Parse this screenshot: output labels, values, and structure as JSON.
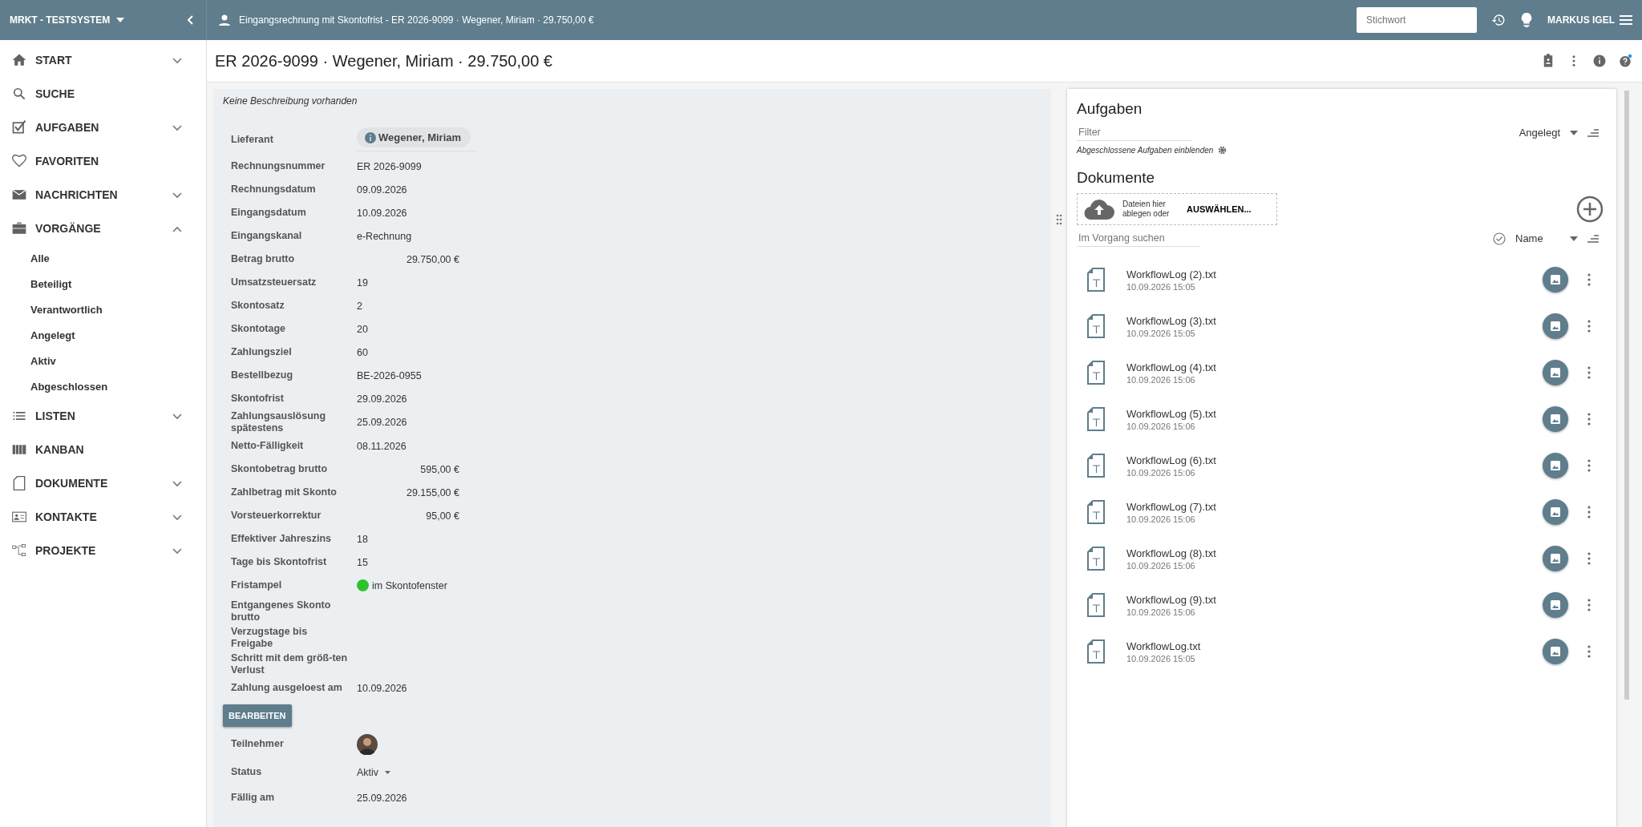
{
  "topbar": {
    "system": "MRKT - TESTSYSTEM",
    "title": "Eingangsrechnung mit Skontofrist - ER 2026-9099 · Wegener, Miriam · 29.750,00 €",
    "search": {
      "placeholder": "Stichwort"
    },
    "user": "MARKUS IGEL"
  },
  "sidebar": {
    "items": [
      {
        "label": "START",
        "expanded": false
      },
      {
        "label": "SUCHE"
      },
      {
        "label": "AUFGABEN",
        "expanded": false
      },
      {
        "label": "FAVORITEN"
      },
      {
        "label": "NACHRICHTEN",
        "expanded": false
      },
      {
        "label": "VORGÄNGE",
        "expanded": true,
        "children": [
          {
            "label": "Alle"
          },
          {
            "label": "Beteiligt"
          },
          {
            "label": "Verantwortlich"
          },
          {
            "label": "Angelegt"
          },
          {
            "label": "Aktiv"
          },
          {
            "label": "Abgeschlossen"
          }
        ]
      },
      {
        "label": "LISTEN",
        "expanded": false
      },
      {
        "label": "KANBAN"
      },
      {
        "label": "DOKUMENTE",
        "expanded": false
      },
      {
        "label": "KONTAKTE",
        "expanded": false
      },
      {
        "label": "PROJEKTE",
        "expanded": false
      }
    ]
  },
  "page_title": "ER 2026-9099 · Wegener, Miriam · 29.750,00 €",
  "details": {
    "description": "Keine Beschreibung vorhanden",
    "fields": [
      {
        "label": "Lieferant",
        "kind": "chip",
        "value": "Wegener, Miriam"
      },
      {
        "label": "Rechnungsnummer",
        "kind": "text",
        "value": "ER 2026-9099"
      },
      {
        "label": "Rechnungsdatum",
        "kind": "text",
        "value": "09.09.2026"
      },
      {
        "label": "Eingangsdatum",
        "kind": "text",
        "value": "10.09.2026"
      },
      {
        "label": "Eingangskanal",
        "kind": "text",
        "value": "e-Rechnung"
      },
      {
        "label": "Betrag brutto",
        "kind": "amount",
        "value": "29.750,00 €"
      },
      {
        "label": "Umsatzsteuersatz",
        "kind": "text",
        "value": "19"
      },
      {
        "label": "Skontosatz",
        "kind": "text",
        "value": "2"
      },
      {
        "label": "Skontotage",
        "kind": "text",
        "value": "20"
      },
      {
        "label": "Zahlungsziel",
        "kind": "text",
        "value": "60"
      },
      {
        "label": "Bestellbezug",
        "kind": "text",
        "value": "BE-2026-0955"
      },
      {
        "label": "Skontofrist",
        "kind": "text",
        "value": "29.09.2026"
      },
      {
        "label": "Zahlungsauslösung spätestens",
        "kind": "text",
        "value": "25.09.2026"
      },
      {
        "label": "Netto-Fälligkeit",
        "kind": "text",
        "value": "08.11.2026"
      },
      {
        "label": "Skontobetrag brutto",
        "kind": "amount",
        "value": "595,00 €"
      },
      {
        "label": "Zahlbetrag mit Skonto",
        "kind": "amount",
        "value": "29.155,00 €"
      },
      {
        "label": "Vorsteuerkorrektur",
        "kind": "amount",
        "value": "95,00 €"
      },
      {
        "label": "Effektiver Jahreszins",
        "kind": "text",
        "value": "18"
      },
      {
        "label": "Tage bis Skontofrist",
        "kind": "text",
        "value": "15"
      },
      {
        "label": "Fristampel",
        "kind": "status",
        "value": "im Skontofenster",
        "color": "#2ec32e"
      },
      {
        "label": "Entgangenes Skonto brutto",
        "kind": "empty"
      },
      {
        "label": "Verzugstage bis Freigabe",
        "kind": "empty"
      },
      {
        "label": "Schritt mit dem größ-ten Verlust",
        "kind": "empty"
      },
      {
        "label": "Zahlung ausgeloest am",
        "kind": "text",
        "value": "10.09.2026"
      }
    ],
    "edit_button": "BEARBEITEN",
    "meta": [
      {
        "label": "Teilnehmer",
        "kind": "avatar"
      },
      {
        "label": "Status",
        "kind": "dropdown",
        "value": "Aktiv"
      },
      {
        "label": "Fällig am",
        "kind": "text",
        "value": "25.09.2026"
      }
    ]
  },
  "tasks": {
    "title": "Aufgaben",
    "filter": {
      "placeholder": "Filter"
    },
    "sort": "Angelegt",
    "show_closed": "Abgeschlossene Aufgaben einblenden"
  },
  "documents": {
    "title": "Dokumente",
    "drop_text": "Dateien hier ablegen oder",
    "choose": "AUSWÄHLEN...",
    "search": {
      "placeholder": "Im Vorgang suchen"
    },
    "sort": "Name",
    "files": [
      {
        "name": "WorkflowLog (2).txt",
        "date": "10.09.2026 15:05"
      },
      {
        "name": "WorkflowLog (3).txt",
        "date": "10.09.2026 15:05"
      },
      {
        "name": "WorkflowLog (4).txt",
        "date": "10.09.2026 15:06"
      },
      {
        "name": "WorkflowLog (5).txt",
        "date": "10.09.2026 15:06"
      },
      {
        "name": "WorkflowLog (6).txt",
        "date": "10.09.2026 15:06"
      },
      {
        "name": "WorkflowLog (7).txt",
        "date": "10.09.2026 15:06"
      },
      {
        "name": "WorkflowLog (8).txt",
        "date": "10.09.2026 15:06"
      },
      {
        "name": "WorkflowLog (9).txt",
        "date": "10.09.2026 15:06"
      },
      {
        "name": "WorkflowLog.txt",
        "date": "10.09.2026 15:05"
      }
    ]
  }
}
